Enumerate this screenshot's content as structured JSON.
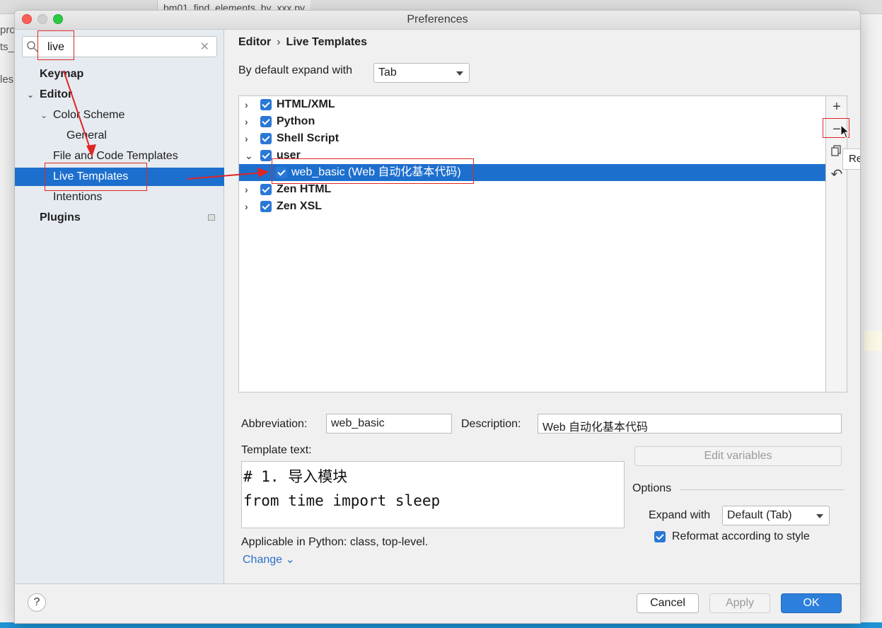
{
  "window": {
    "title": "Preferences"
  },
  "background": {
    "tab_label": "bm01_find_elements_by_xxx.py",
    "left_fragments": [
      "pro",
      "ts_",
      "les"
    ]
  },
  "sidebar": {
    "search_value": "live",
    "items": [
      {
        "label": "Keymap",
        "bold": true
      },
      {
        "label": "Editor",
        "bold": true,
        "expanded": true
      },
      {
        "label": "Color Scheme",
        "expanded": true
      },
      {
        "label": "General"
      },
      {
        "label": "File and Code Templates"
      },
      {
        "label": "Live Templates",
        "selected": true
      },
      {
        "label": "Intentions"
      },
      {
        "label": "Plugins",
        "bold": true
      }
    ]
  },
  "breadcrumb": {
    "parent": "Editor",
    "separator": "›",
    "current": "Live Templates"
  },
  "expand_default": {
    "label": "By default expand with",
    "value": "Tab"
  },
  "template_groups": [
    {
      "label": "HTML/XML",
      "checked": true,
      "expanded": false
    },
    {
      "label": "Python",
      "checked": true,
      "expanded": false
    },
    {
      "label": "Shell Script",
      "checked": true,
      "expanded": false
    },
    {
      "label": "user",
      "checked": true,
      "expanded": true
    },
    {
      "label": "web_basic (Web 自动化基本代码)",
      "checked": true,
      "child": true,
      "selected": true
    },
    {
      "label": "Zen HTML",
      "checked": true,
      "expanded": false
    },
    {
      "label": "Zen XSL",
      "checked": true,
      "expanded": false
    }
  ],
  "side_tools": {
    "add": "+",
    "remove": "−",
    "copy": "copy-icon",
    "restore": "↶"
  },
  "tooltip": "Remove",
  "form": {
    "abbreviation_label": "Abbreviation:",
    "abbreviation_value": "web_basic",
    "description_label": "Description:",
    "description_value": "Web 自动化基本代码",
    "template_text_label": "Template text:",
    "template_text": "# 1. 导入模块\nfrom time import sleep",
    "edit_variables": "Edit variables",
    "options_label": "Options",
    "expand_with_label": "Expand with",
    "expand_with_value": "Default (Tab)",
    "reformat_label": "Reformat according to style",
    "reformat_checked": true,
    "applicable": "Applicable in Python: class, top-level.",
    "change_link": "Change ⌄"
  },
  "footer": {
    "help": "?",
    "cancel": "Cancel",
    "apply": "Apply",
    "ok": "OK"
  },
  "colors": {
    "selection": "#1d6fce",
    "annotation": "#e02525",
    "primary_button": "#2c7fdb"
  }
}
